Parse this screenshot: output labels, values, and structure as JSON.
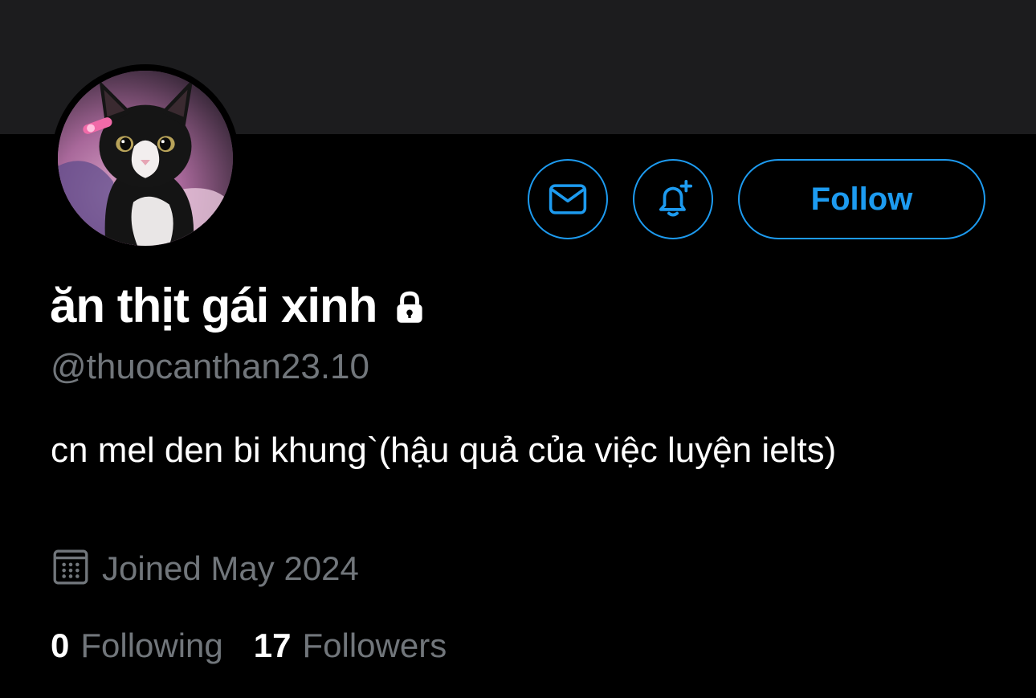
{
  "profile": {
    "display_name": "ăn thịt gái xinh",
    "handle": "@thuocanthan23.10",
    "bio": "cn mel den bi khung`(hậu quả của việc luyện ielts)",
    "joined": "Joined May 2024",
    "protected_icon": "lock-icon",
    "avatar": "cat-photo"
  },
  "actions": {
    "message_icon": "mail-icon",
    "notify_icon": "bell-plus-icon",
    "follow_label": "Follow"
  },
  "stats": {
    "following_count": "0",
    "following_label": "Following",
    "followers_count": "17",
    "followers_label": "Followers"
  },
  "colors": {
    "background": "#000000",
    "banner": "#1c1c1e",
    "accent": "#1d9bf0",
    "primary_text": "#ffffff",
    "secondary_text": "#71767b"
  }
}
